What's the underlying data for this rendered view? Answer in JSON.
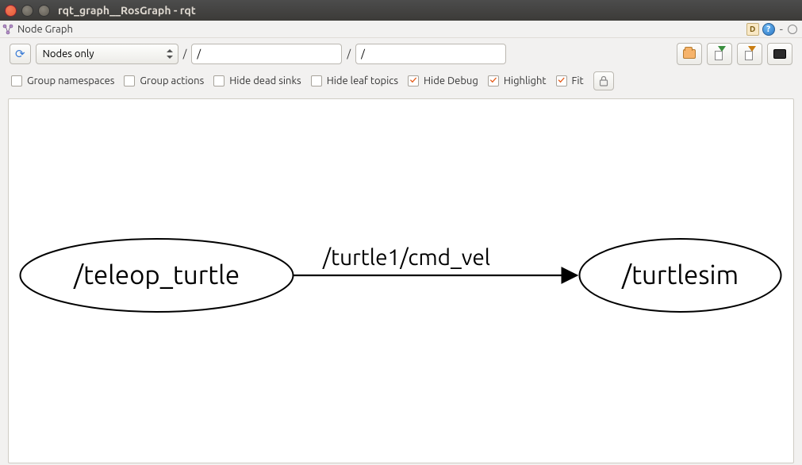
{
  "window": {
    "title": "rqt_graph__RosGraph - rqt"
  },
  "menubar": {
    "plugin_label": "Node Graph",
    "d_badge": "D",
    "help_badge": "?",
    "dash": "-"
  },
  "toolbar": {
    "filter_mode": "Nodes only",
    "topic_filter_value": "/",
    "node_filter_value": "/"
  },
  "options": {
    "group_namespaces": {
      "label": "Group namespaces",
      "checked": false
    },
    "group_actions": {
      "label": "Group actions",
      "checked": false
    },
    "hide_dead_sinks": {
      "label": "Hide dead sinks",
      "checked": false
    },
    "hide_leaf_topics": {
      "label": "Hide leaf topics",
      "checked": false
    },
    "hide_debug": {
      "label": "Hide Debug",
      "checked": true
    },
    "highlight": {
      "label": "Highlight",
      "checked": true
    },
    "fit": {
      "label": "Fit",
      "checked": true
    }
  },
  "graph": {
    "nodes": [
      {
        "id": "teleop",
        "label": "/teleop_turtle"
      },
      {
        "id": "sim",
        "label": "/turtlesim"
      }
    ],
    "edges": [
      {
        "from": "teleop",
        "to": "sim",
        "label": "/turtle1/cmd_vel"
      }
    ]
  }
}
